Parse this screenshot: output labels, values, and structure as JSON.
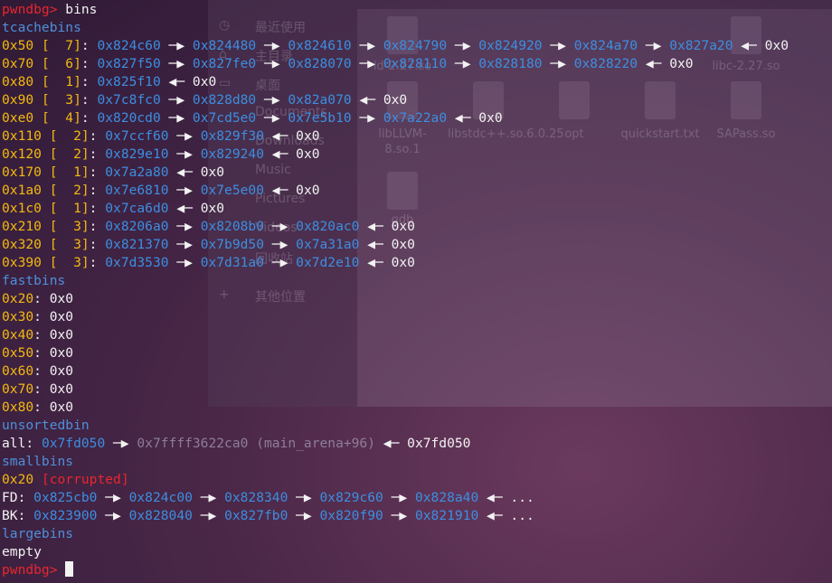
{
  "background_window": {
    "sidebar": [
      "最近使用",
      "主目录",
      "桌面",
      "Documents",
      "Downloads",
      "Music",
      "Pictures",
      "Videos",
      "回收站",
      "其他位置"
    ],
    "files": [
      {
        "name": "ld-2.27.so"
      },
      {
        "name": "libc-2.27.so"
      },
      {
        "name": "libLLVM-8.so.1"
      },
      {
        "name": "libstdc++.so.6.0.25"
      },
      {
        "name": "opt"
      },
      {
        "name": "quickstart.txt"
      },
      {
        "name": "SAPass.so"
      },
      {
        "name": "gdb"
      }
    ]
  },
  "terminal": {
    "prompt": "pwndbg> ",
    "command": "bins",
    "tcache_title": "tcachebins",
    "tcache": [
      {
        "size": "0x50",
        "count": "[  7]",
        "chain": [
          "0x824c60",
          "0x824480",
          "0x824610",
          "0x824790",
          "0x824920",
          "0x824a70",
          "0x827a20"
        ],
        "end": "0x0"
      },
      {
        "size": "0x70",
        "count": "[  6]",
        "chain": [
          "0x827f50",
          "0x827fe0",
          "0x828070",
          "0x828110",
          "0x828180",
          "0x828220"
        ],
        "end": "0x0"
      },
      {
        "size": "0x80",
        "count": "[  1]",
        "chain": [
          "0x825f10"
        ],
        "end": "0x0"
      },
      {
        "size": "0x90",
        "count": "[  3]",
        "chain": [
          "0x7c8fc0",
          "0x828d80",
          "0x82a070"
        ],
        "end": "0x0"
      },
      {
        "size": "0xe0",
        "count": "[  4]",
        "chain": [
          "0x820cd0",
          "0x7cd5e0",
          "0x7e5b10",
          "0x7a22a0"
        ],
        "end": "0x0"
      },
      {
        "size": "0x110",
        "count": "[  2]",
        "chain": [
          "0x7ccf60",
          "0x829f30"
        ],
        "end": "0x0"
      },
      {
        "size": "0x120",
        "count": "[  2]",
        "chain": [
          "0x829e10",
          "0x829240"
        ],
        "end": "0x0"
      },
      {
        "size": "0x170",
        "count": "[  1]",
        "chain": [
          "0x7a2a80"
        ],
        "end": "0x0"
      },
      {
        "size": "0x1a0",
        "count": "[  2]",
        "chain": [
          "0x7e6810",
          "0x7e5e00"
        ],
        "end": "0x0"
      },
      {
        "size": "0x1c0",
        "count": "[  1]",
        "chain": [
          "0x7ca6d0"
        ],
        "end": "0x0"
      },
      {
        "size": "0x210",
        "count": "[  3]",
        "chain": [
          "0x8206a0",
          "0x8208b0",
          "0x820ac0"
        ],
        "end": "0x0"
      },
      {
        "size": "0x320",
        "count": "[  3]",
        "chain": [
          "0x821370",
          "0x7b9d50",
          "0x7a31a0"
        ],
        "end": "0x0"
      },
      {
        "size": "0x390",
        "count": "[  3]",
        "chain": [
          "0x7d3530",
          "0x7d31a0",
          "0x7d2e10"
        ],
        "end": "0x0"
      }
    ],
    "fastbins_title": "fastbins",
    "fastbins": [
      {
        "size": "0x20",
        "value": "0x0"
      },
      {
        "size": "0x30",
        "value": "0x0"
      },
      {
        "size": "0x40",
        "value": "0x0"
      },
      {
        "size": "0x50",
        "value": "0x0"
      },
      {
        "size": "0x60",
        "value": "0x0"
      },
      {
        "size": "0x70",
        "value": "0x0"
      },
      {
        "size": "0x80",
        "value": "0x0"
      }
    ],
    "unsorted_title": "unsortedbin",
    "unsorted": {
      "label": "all",
      "first": "0x7fd050",
      "second": "0x7ffff3622ca0",
      "second_note": "(main_arena+96)",
      "end": "0x7fd050"
    },
    "smallbins_title": "smallbins",
    "smallbin": {
      "size": "0x20",
      "flag": "[corrupted]"
    },
    "fd": {
      "label": "FD",
      "chain": [
        "0x825cb0",
        "0x824c00",
        "0x828340",
        "0x829c60",
        "0x828a40"
      ],
      "end": "..."
    },
    "bk": {
      "label": "BK",
      "chain": [
        "0x823900",
        "0x828040",
        "0x827fb0",
        "0x820f90",
        "0x821910"
      ],
      "end": "..."
    },
    "largebins_title": "largebins",
    "largebins_value": "empty"
  },
  "colors": {
    "prompt": "#e8262e",
    "section": "#4f8fd8",
    "size": "#f2b90f",
    "address": "#3d8ee0",
    "corrupted": "#e8262e"
  }
}
